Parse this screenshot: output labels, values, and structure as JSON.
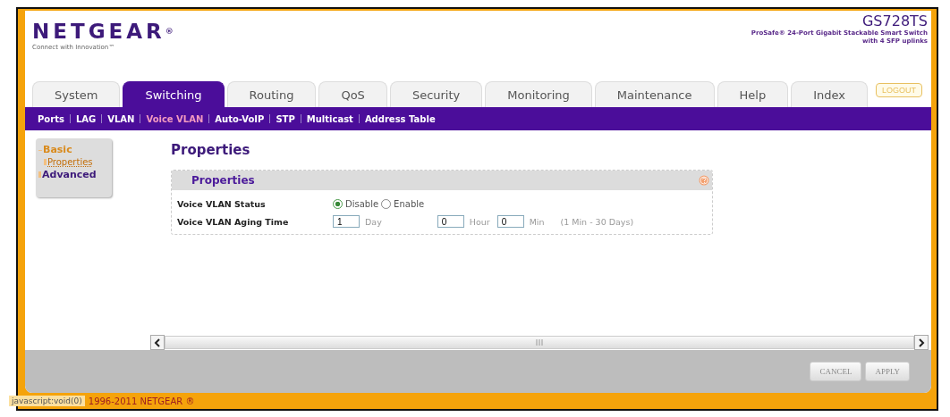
{
  "header": {
    "logo": "NETGEAR",
    "logo_mark": "®",
    "tagline": "Connect with Innovation™",
    "model": "GS728TS",
    "description_lines": [
      "ProSafe® 24-Port Gigabit Stackable Smart Switch",
      "with 4 SFP uplinks"
    ]
  },
  "tabs": [
    {
      "label": "System",
      "selected": false
    },
    {
      "label": "Switching",
      "selected": true
    },
    {
      "label": "Routing",
      "selected": false
    },
    {
      "label": "QoS",
      "selected": false
    },
    {
      "label": "Security",
      "selected": false
    },
    {
      "label": "Monitoring",
      "selected": false
    },
    {
      "label": "Maintenance",
      "selected": false
    },
    {
      "label": "Help",
      "selected": false
    },
    {
      "label": "Index",
      "selected": false
    }
  ],
  "logout_button": "LOGOUT",
  "subnav": [
    {
      "label": "Ports",
      "selected": false
    },
    {
      "label": "LAG",
      "selected": false
    },
    {
      "label": "VLAN",
      "selected": false
    },
    {
      "label": "Voice VLAN",
      "selected": true
    },
    {
      "label": "Auto-VoIP",
      "selected": false
    },
    {
      "label": "STP",
      "selected": false
    },
    {
      "label": "Multicast",
      "selected": false
    },
    {
      "label": "Address Table",
      "selected": false
    }
  ],
  "sidebar": {
    "items": [
      {
        "label": "Basic",
        "selected": false,
        "expanded": true,
        "children": [
          {
            "label": "Properties",
            "selected": true
          }
        ]
      },
      {
        "label": "Advanced",
        "selected": false,
        "expanded": false
      }
    ]
  },
  "page_title": "Properties",
  "panel": {
    "title": "Properties",
    "rows": [
      {
        "kind": "radio",
        "label": "Voice VLAN Status",
        "options": [
          {
            "label": "Disable",
            "selected": true
          },
          {
            "label": "Enable",
            "selected": false
          }
        ]
      },
      {
        "kind": "fields",
        "label": "Voice VLAN Aging Time",
        "fields": [
          {
            "value": "1",
            "unit": "Day"
          },
          {
            "value": "0",
            "unit": "Hour"
          },
          {
            "value": "0",
            "unit": "Min"
          }
        ],
        "hint": "(1 Min - 30 Days)"
      }
    ]
  },
  "buttons": [
    "CANCEL",
    "APPLY"
  ],
  "status_bar": {
    "link": "javascript:void(0)",
    "copyright": "1996-2011 NETGEAR ®"
  }
}
